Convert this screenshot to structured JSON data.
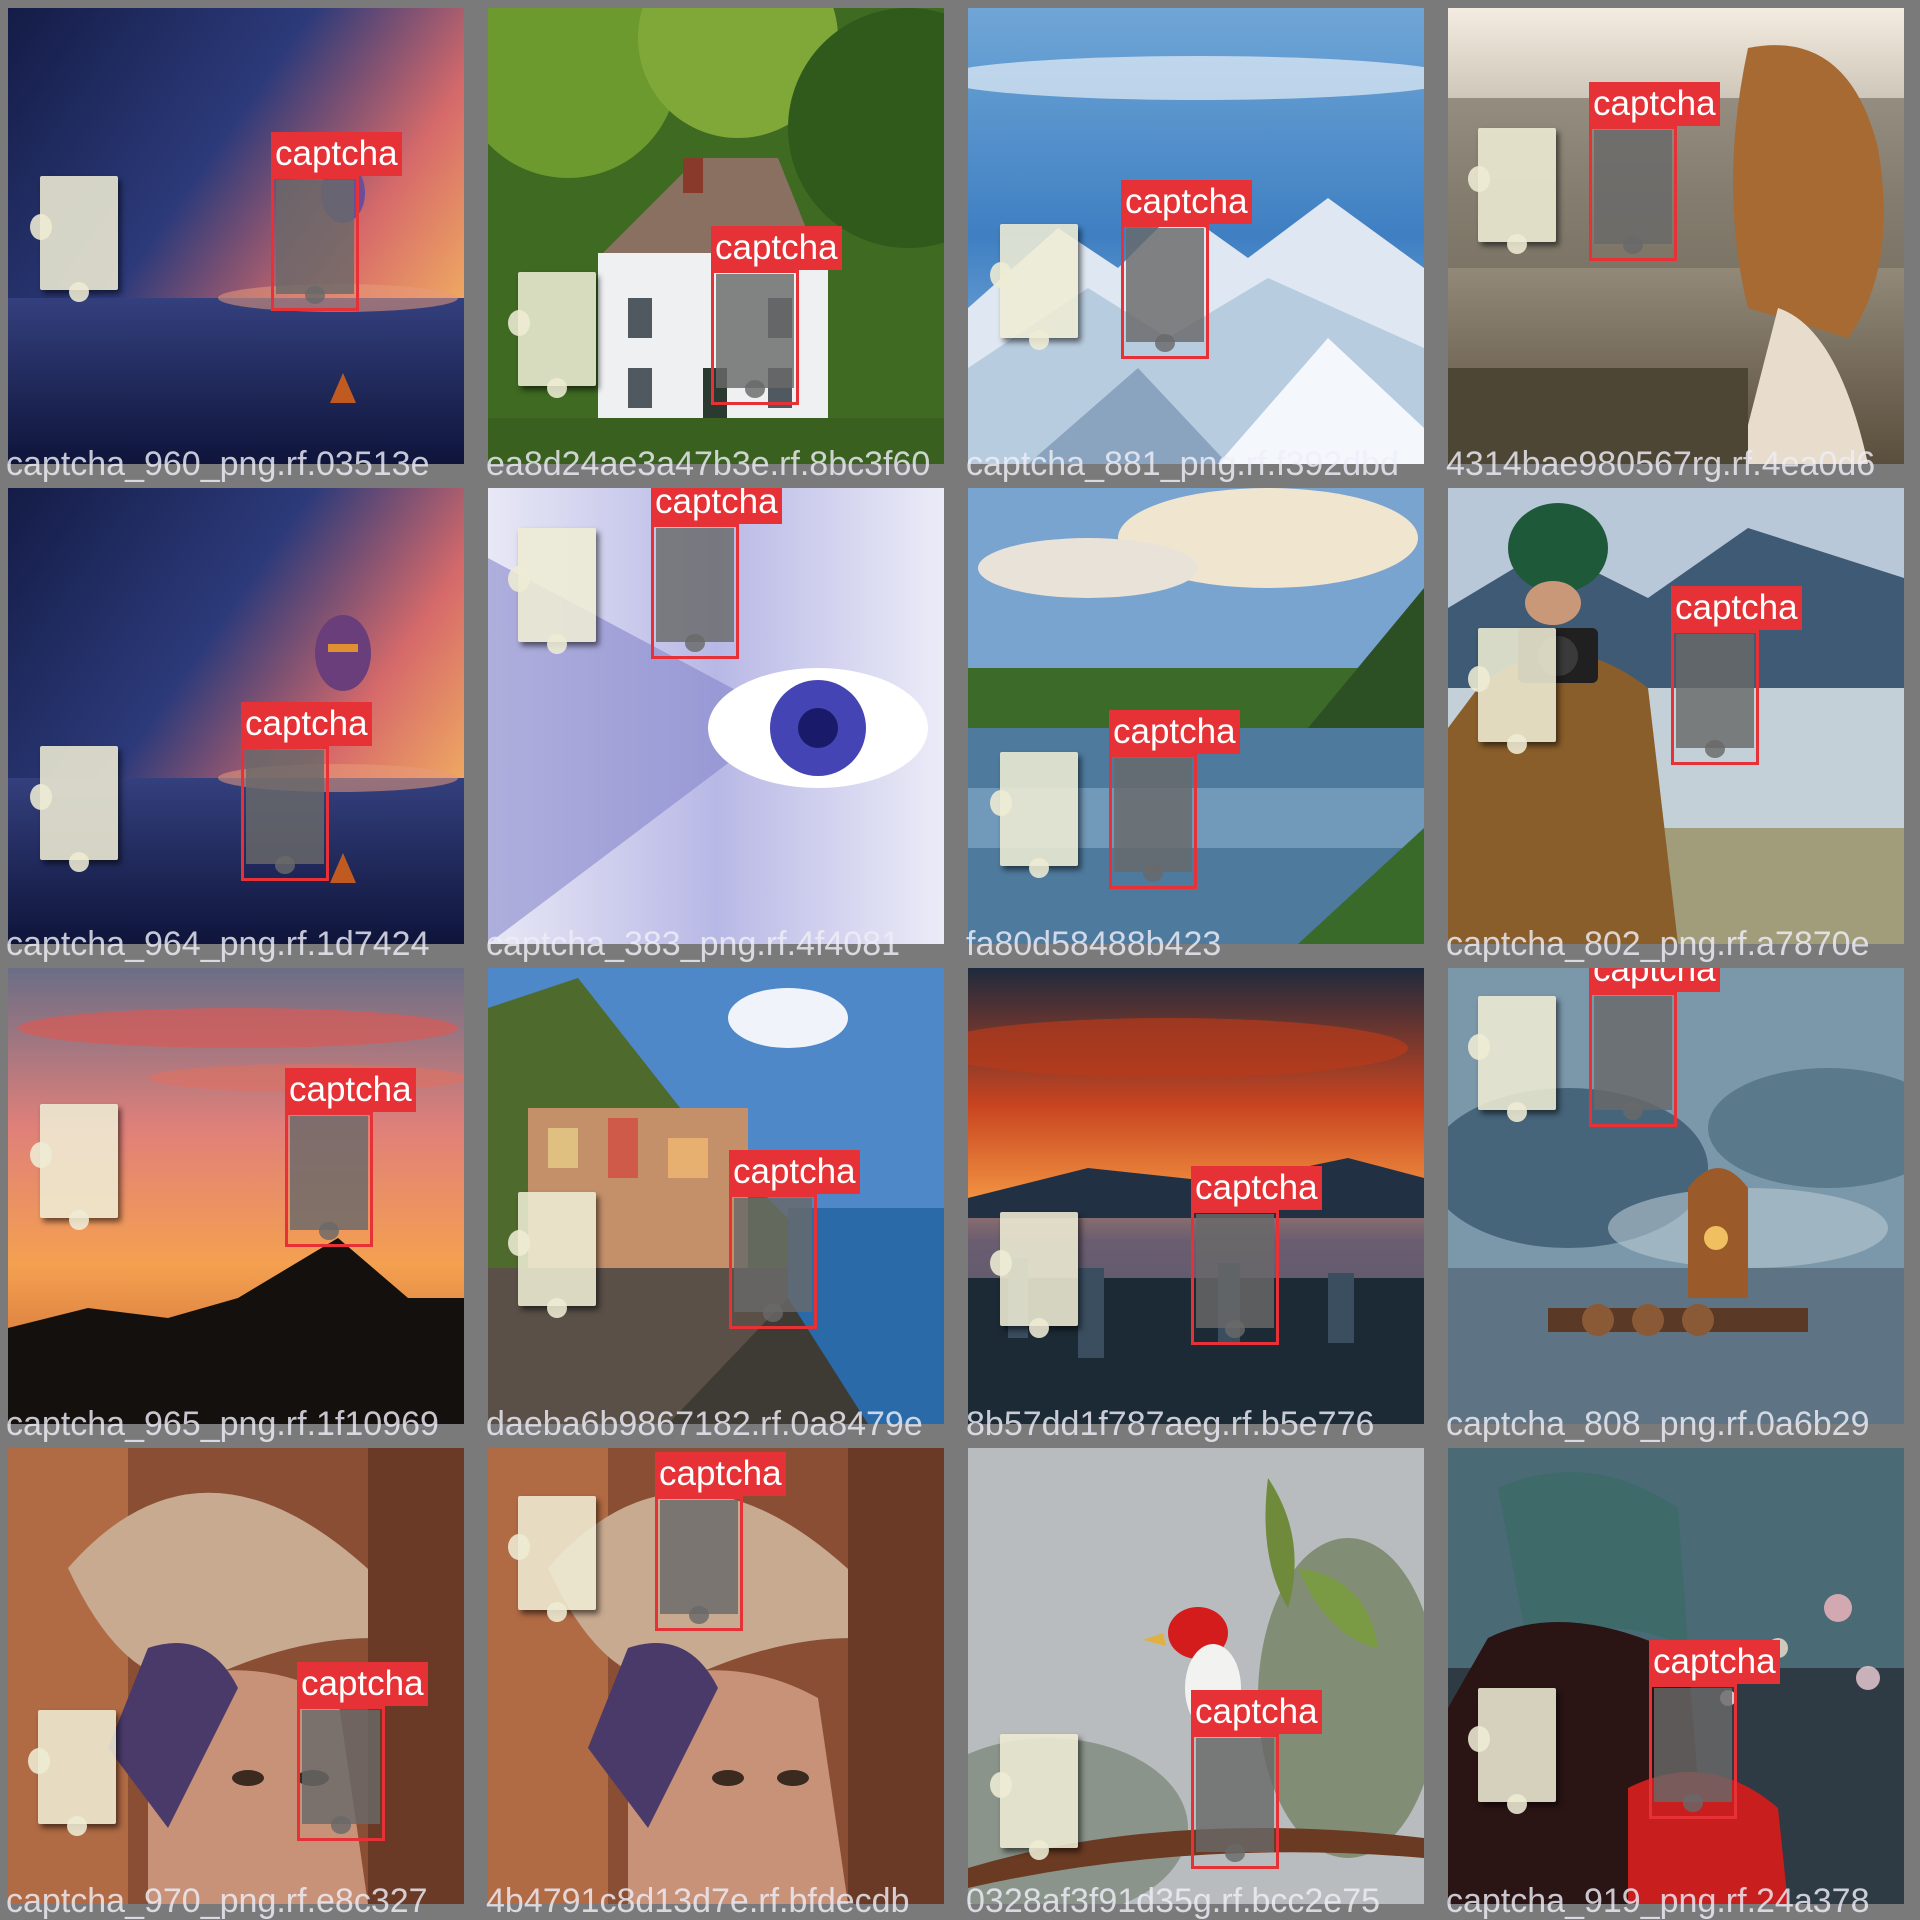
{
  "class_label": "captcha",
  "tiles": [
    {
      "caption": "captcha_960_png.rf.03513e",
      "scene": "sea-sunset-balloon"
    },
    {
      "caption": "ea8d24ae3a47b3e.rf.8bc3f60",
      "scene": "white-house-trees"
    },
    {
      "caption": "captcha_881_png.rf.f392dbd",
      "scene": "snowy-mountains"
    },
    {
      "caption": "4314bae980567rg.rf.4ea0d6",
      "scene": "woman-curly-hair"
    },
    {
      "caption": "captcha_964_png.rf.1d7424",
      "scene": "sea-sunset-balloon"
    },
    {
      "caption": "captcha_383_png.rf.4f4081",
      "scene": "binary-eye"
    },
    {
      "caption": "fa80d58488b423",
      "scene": "lake-forest-clouds"
    },
    {
      "caption": "captcha_802_png.rf.a7870e",
      "scene": "photographer-lake"
    },
    {
      "caption": "captcha_965_png.rf.1f10969",
      "scene": "orange-sunset-hills"
    },
    {
      "caption": "daeba6b9867182.rf.0a8479e",
      "scene": "cliff-village-sea"
    },
    {
      "caption": "8b57dd1f787aeg.rf.b5e776",
      "scene": "red-sky-city"
    },
    {
      "caption": "captcha_808_png.rf.0a6b29",
      "scene": "fisherman-river-mist"
    },
    {
      "caption": "captcha_970_png.rf.e8c327",
      "scene": "woman-with-hat"
    },
    {
      "caption": "4b4791c8d13d7e.rf.bfdecdb",
      "scene": "woman-with-hat"
    },
    {
      "caption": "0328af3f91d35g.rf.bcc2e75",
      "scene": "red-headed-bird"
    },
    {
      "caption": "captcha_919_png.rf.24a378",
      "scene": "woman-beanie-bokeh"
    }
  ],
  "colors": {
    "box": "#e63236",
    "background": "#7a7a7a"
  }
}
